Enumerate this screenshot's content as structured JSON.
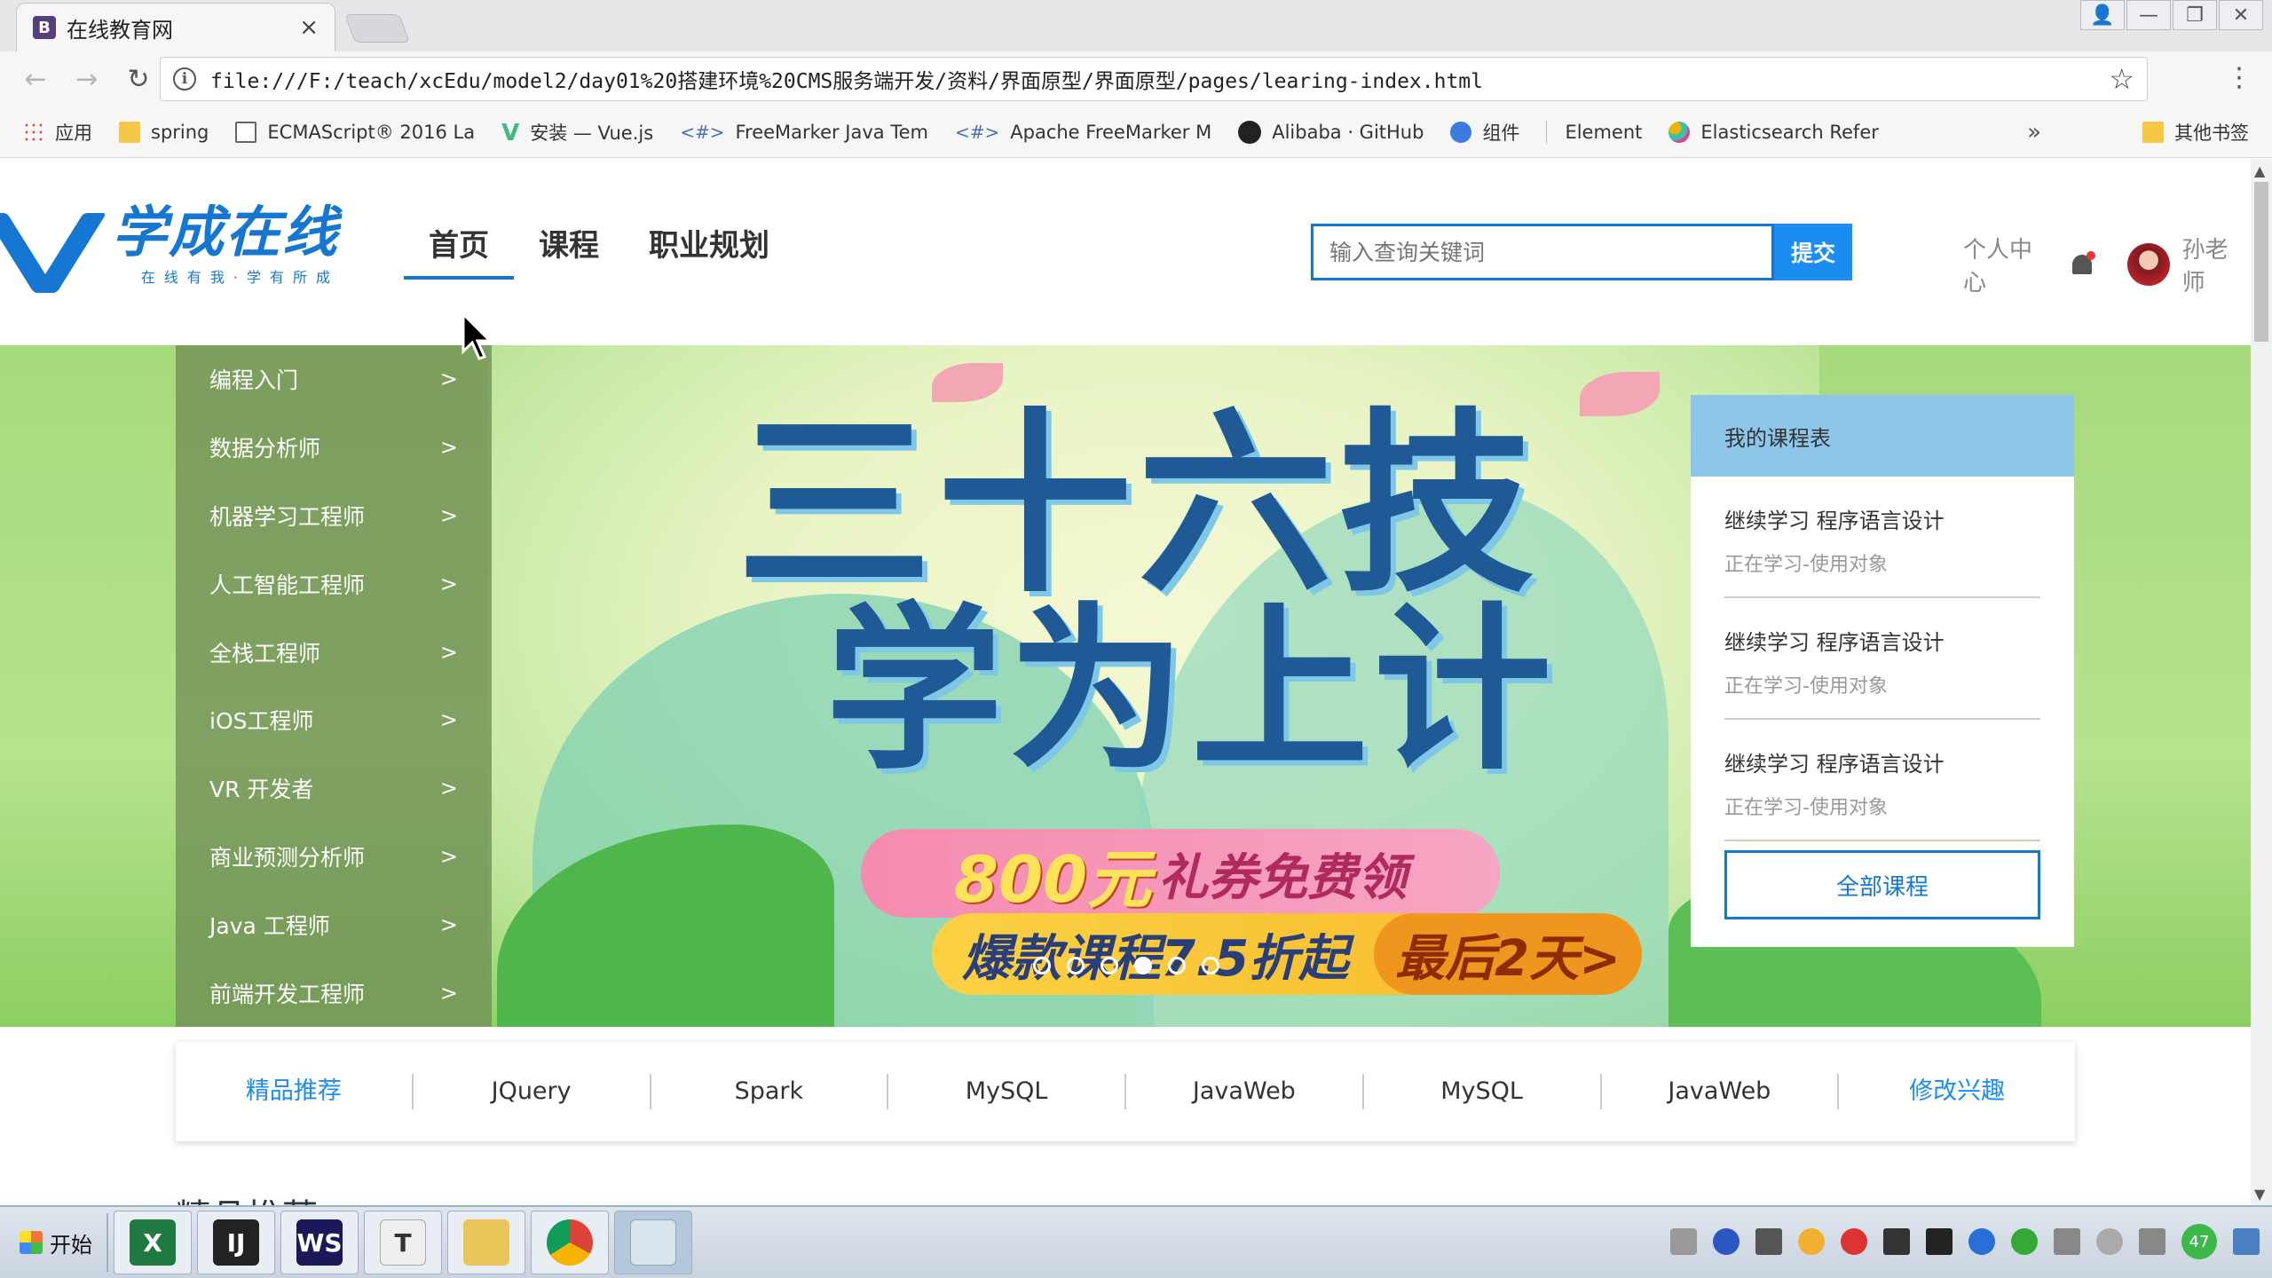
{
  "browser": {
    "tab_title": "在线教育网",
    "tab_favicon": "B",
    "tab_close": "×",
    "url": "file:///F:/teach/xcEdu/model2/day01%20搭建环境%20CMS服务端开发/资料/界面原型/界面原型/pages/learing-index.html",
    "back": "←",
    "forward": "→",
    "reload": "↻",
    "info": "i",
    "star": "☆",
    "menu": "⋮",
    "window_user": "👤",
    "window_min": "—",
    "window_restore": "❐",
    "window_close": "✕"
  },
  "bookmarks": {
    "items": [
      {
        "icon": "apps-icon",
        "label": "应用"
      },
      {
        "icon": "folder-icon",
        "label": "spring"
      },
      {
        "icon": "page-icon",
        "label": "ECMAScript® 2016 La"
      },
      {
        "icon": "vue-icon",
        "label": "安装 — Vue.js"
      },
      {
        "icon": "hash-icon",
        "label": "FreeMarker Java Tem"
      },
      {
        "icon": "hash-icon",
        "label": "Apache FreeMarker M"
      },
      {
        "icon": "github-icon",
        "label": "Alibaba · GitHub"
      },
      {
        "icon": "shield-icon",
        "label": "组件"
      },
      {
        "icon": "none",
        "label": "Element"
      },
      {
        "icon": "elastic-icon",
        "label": "Elasticsearch Refer"
      }
    ],
    "more": "»",
    "other": "其他书签"
  },
  "header": {
    "logo_name": "学成在线",
    "logo_slogan": "在线有我·学有所成",
    "nav": [
      "首页",
      "课程",
      "职业规划"
    ],
    "search_placeholder": "输入查询关键词",
    "search_button": "提交",
    "user_center": "个人中心",
    "username": "孙老师"
  },
  "categories": [
    "编程入门",
    "数据分析师",
    "机器学习工程师",
    "人工智能工程师",
    "全栈工程师",
    "iOS工程师",
    "VR 开发者",
    "商业预测分析师",
    "Java 工程师",
    "前端开发工程师"
  ],
  "category_arrow": ">",
  "banner": {
    "line1": "三十六技",
    "line2": "学为上计",
    "coupon_amount": "800元",
    "coupon_text": "礼券免费领",
    "promo": "爆款课程7.5折起",
    "promo_last": "最后2天>",
    "slides": 6,
    "active_slide": 4
  },
  "schedule": {
    "title": "我的课程表",
    "items": [
      {
        "title": "继续学习 程序语言设计",
        "sub": "正在学习-使用对象"
      },
      {
        "title": "继续学习 程序语言设计",
        "sub": "正在学习-使用对象"
      },
      {
        "title": "继续学习 程序语言设计",
        "sub": "正在学习-使用对象"
      }
    ],
    "all_button": "全部课程"
  },
  "tags": {
    "items": [
      "精品推荐",
      "JQuery",
      "Spark",
      "MySQL",
      "JavaWeb",
      "MySQL",
      "JavaWeb",
      "修改兴趣"
    ],
    "highlighted": [
      "精品推荐",
      "修改兴趣"
    ]
  },
  "section_peek": "精品推荐",
  "taskbar": {
    "start": "开始",
    "apps": [
      {
        "name": "excel-icon",
        "label": "X",
        "color": "#1f7a3f"
      },
      {
        "name": "intellij-icon",
        "label": "IJ",
        "color": "#222222"
      },
      {
        "name": "webstorm-icon",
        "label": "WS",
        "color": "#1a1a5a"
      },
      {
        "name": "typora-icon",
        "label": "T",
        "color": "#eeeeee"
      },
      {
        "name": "folder-icon",
        "label": "",
        "color": "#e9c55a"
      },
      {
        "name": "chrome-icon",
        "label": "",
        "color": "#dd4433"
      },
      {
        "name": "paint-icon",
        "label": "",
        "color": "#d9e4ef"
      }
    ],
    "clock_badge": "47"
  }
}
